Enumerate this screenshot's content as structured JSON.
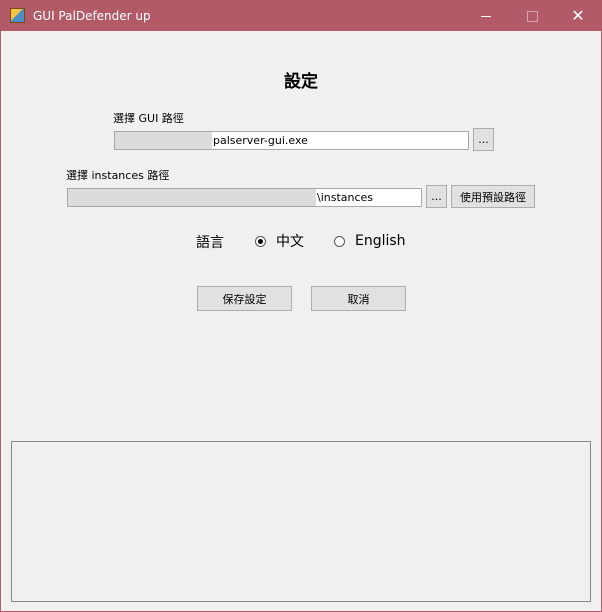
{
  "window": {
    "title": "GUI PalDefender up",
    "icon": "paldefender-app-icon",
    "controls": {
      "minimize": "minimize-icon",
      "maximize": "maximize-icon",
      "close": "✕"
    }
  },
  "heading": "設定",
  "gui_path": {
    "label": "選擇 GUI 路徑",
    "value": "palserver-gui.exe",
    "browse_label": "..."
  },
  "instances_path": {
    "label": "選擇 instances 路徑",
    "value": "\\instances",
    "browse_label": "...",
    "default_label": "使用預設路徑"
  },
  "language": {
    "label": "語言",
    "options": [
      {
        "label": "中文",
        "selected": true
      },
      {
        "label": "English",
        "selected": false
      }
    ]
  },
  "buttons": {
    "save": "保存設定",
    "cancel": "取消"
  },
  "colors": {
    "titlebar": "#b35a68",
    "background": "#f0f0f0"
  }
}
